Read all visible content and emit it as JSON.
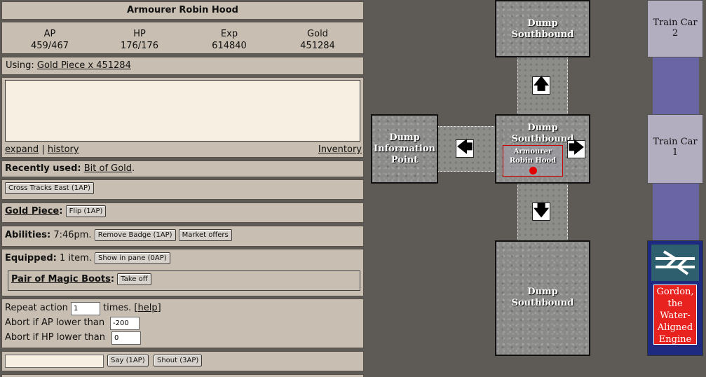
{
  "character": {
    "title": "Armourer Robin Hood"
  },
  "stats": [
    {
      "label": "AP",
      "value": "459/467"
    },
    {
      "label": "HP",
      "value": "176/176"
    },
    {
      "label": "Exp",
      "value": "614840"
    },
    {
      "label": "Gold",
      "value": "451284"
    }
  ],
  "using": {
    "label": "Using:",
    "item": "Gold Piece x 451284"
  },
  "log": {
    "expand": "expand",
    "separator": "|",
    "history": "history",
    "inventory": "Inventory"
  },
  "recently_used": {
    "label": "Recently used:",
    "item": "Bit of Gold",
    "suffix": "."
  },
  "actions": {
    "cross_tracks": "Cross Tracks East (1AP)"
  },
  "gold_piece": {
    "label": "Gold Piece",
    "colon": ":",
    "flip": "Flip (1AP)"
  },
  "abilities": {
    "label": "Abilities:",
    "time": "7:46pm.",
    "remove_badge": "Remove Badge (1AP)",
    "market": "Market offers"
  },
  "equipped": {
    "label": "Equipped:",
    "count": "1 item.",
    "show_pane": "Show in pane (0AP)",
    "item": "Pair of Magic Boots",
    "colon": ":",
    "take_off": "Take off"
  },
  "repeat": {
    "label": "Repeat action",
    "value": "1",
    "times": "times.",
    "help_open": "[",
    "help": "help",
    "help_close": "]",
    "ap_label": "Abort if AP lower than",
    "ap_value": "-200",
    "hp_label": "Abort if HP lower than",
    "hp_value": "0"
  },
  "chat": {
    "say": "Say (1AP)",
    "shout": "Shout (3AP)"
  },
  "map": {
    "north_tile": "Dump Southbound",
    "center_tile": "Dump Southbound",
    "player_name": "Armourer Robin Hood",
    "west_tile": "Dump Information Point",
    "south_tile": "Dump Southbound",
    "arrows": {
      "up": "🡅",
      "down": "🡇",
      "left": "🡄",
      "right": "🡆"
    }
  },
  "train": {
    "car2": "Train Car 2",
    "car1": "Train Car 1",
    "engine": "Gordon, the Water-Aligned Engine",
    "logo_icon": "british-rail-icon"
  },
  "colors": {
    "panel_bg": "#c8beb1",
    "player_dot": "#e00000",
    "engine_red": "#e8231f",
    "track": "#6a66a6"
  }
}
